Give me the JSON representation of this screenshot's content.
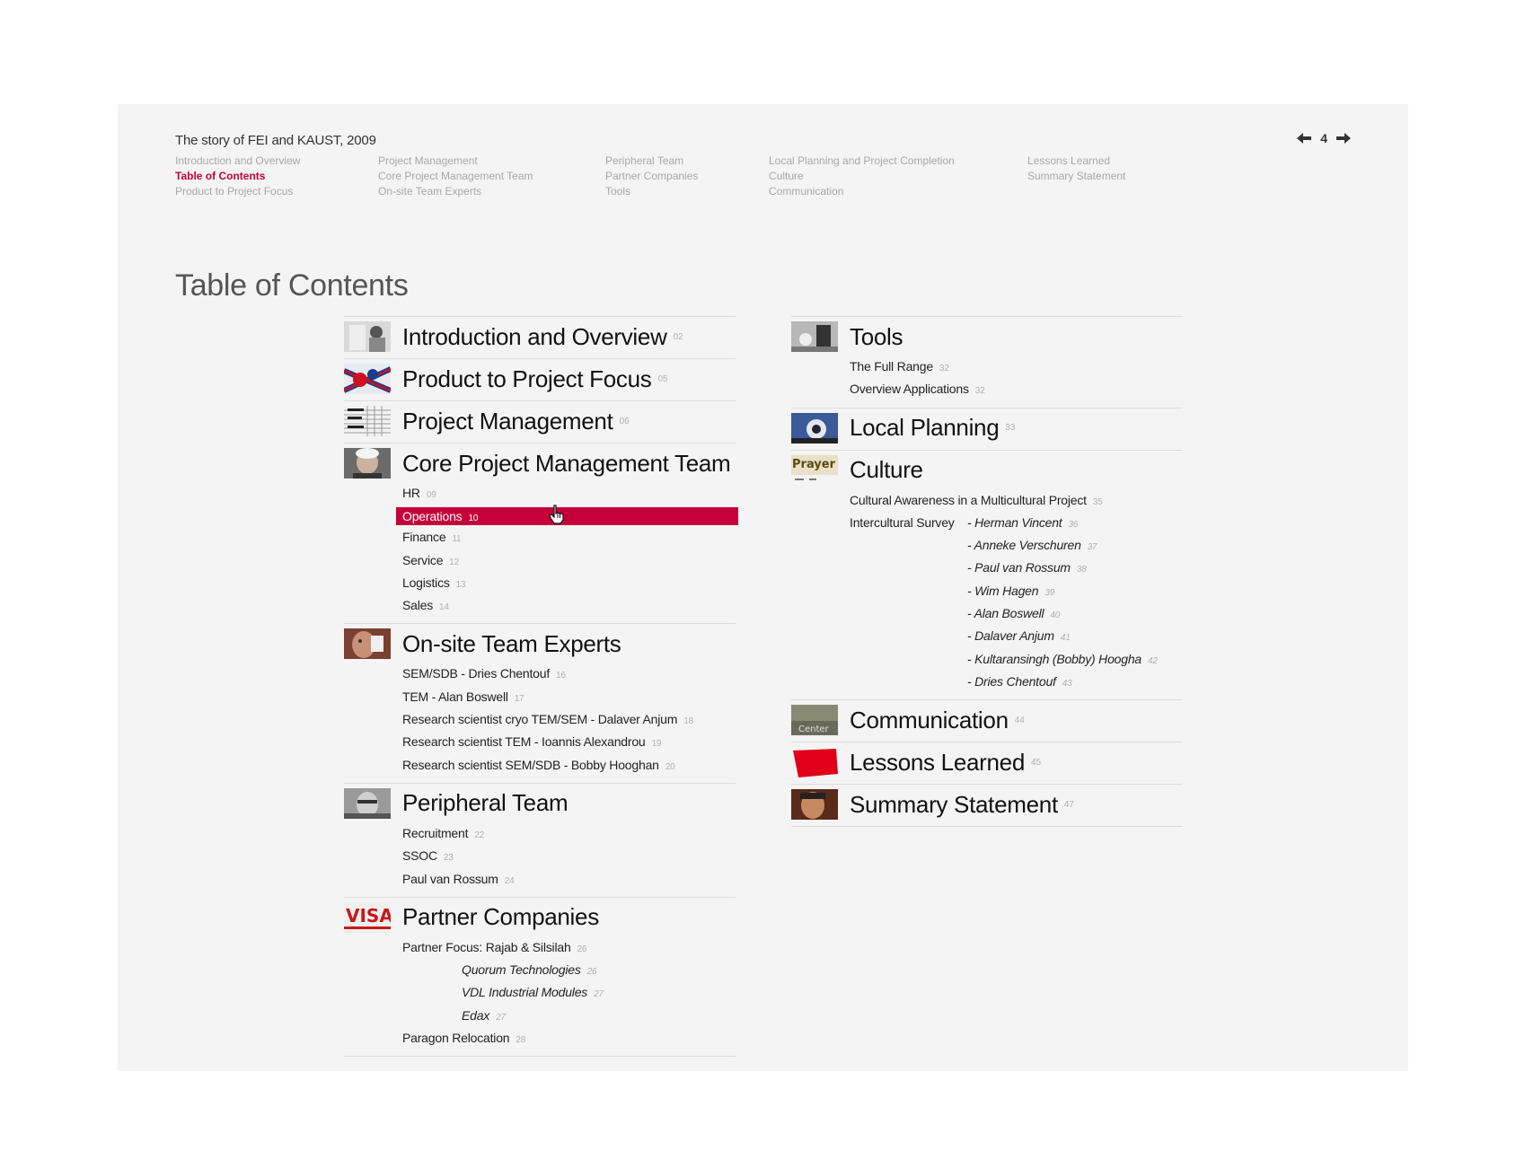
{
  "header": {
    "doc_title": "The story of FEI and KAUST, 2009",
    "page_number": "4"
  },
  "topnav": {
    "col1": [
      "Introduction and Overview",
      "Table of Contents",
      "Product to Project Focus"
    ],
    "col2": [
      "Project Management",
      "Core Project Management Team",
      "On-site Team Experts"
    ],
    "col3": [
      "Peripheral Team",
      "Partner Companies",
      "Tools"
    ],
    "col4": [
      "Local Planning and Project Completion",
      "Culture",
      "Communication"
    ],
    "col5": [
      "Lessons Learned",
      "Summary Statement"
    ]
  },
  "page_title": "Table of Contents",
  "left": {
    "intro": {
      "title": "Introduction and Overview",
      "page": "02"
    },
    "product": {
      "title": "Product to Project Focus",
      "page": "05"
    },
    "pm": {
      "title": "Project Management",
      "page": "06"
    },
    "core": {
      "title": "Core Project Management Team",
      "subs": [
        {
          "label": "HR",
          "page": "09"
        },
        {
          "label": "Operations",
          "page": "10"
        },
        {
          "label": "Finance",
          "page": "11"
        },
        {
          "label": "Service",
          "page": "12"
        },
        {
          "label": "Logistics",
          "page": "13"
        },
        {
          "label": "Sales",
          "page": "14"
        }
      ]
    },
    "onsite": {
      "title": "On-site Team Experts",
      "subs": [
        {
          "label": "SEM/SDB - Dries Chentouf",
          "page": "16"
        },
        {
          "label": "TEM - Alan Boswell",
          "page": "17"
        },
        {
          "label": "Research scientist cryo TEM/SEM - Dalaver Anjum",
          "page": "18"
        },
        {
          "label": "Research scientist TEM - Ioannis Alexandrou",
          "page": "19"
        },
        {
          "label": "Research scientist SEM/SDB - Bobby Hooghan",
          "page": "20"
        }
      ]
    },
    "peripheral": {
      "title": "Peripheral Team",
      "subs": [
        {
          "label": "Recruitment",
          "page": "22"
        },
        {
          "label": "SSOC",
          "page": "23"
        },
        {
          "label": "Paul van Rossum",
          "page": "24"
        }
      ]
    },
    "partner": {
      "title": "Partner Companies",
      "subs": [
        {
          "label": "Partner Focus: Rajab & Silsilah",
          "page": "26"
        },
        {
          "label": "Quorum Technologies",
          "page": "26"
        },
        {
          "label": "VDL Industrial Modules",
          "page": "27"
        },
        {
          "label": "Edax",
          "page": "27"
        },
        {
          "label": "Paragon Relocation",
          "page": "28"
        }
      ]
    }
  },
  "right": {
    "tools": {
      "title": "Tools",
      "subs": [
        {
          "label": "The Full Range",
          "page": "32"
        },
        {
          "label": "Overview Applications",
          "page": "32"
        }
      ]
    },
    "local": {
      "title": "Local Planning",
      "page": "33"
    },
    "culture": {
      "title": "Culture",
      "awareness": {
        "label": "Cultural Awareness in a Multicultural Project",
        "page": "35"
      },
      "survey_label": "Intercultural Survey",
      "survey": [
        {
          "label": "- Herman Vincent",
          "page": "36"
        },
        {
          "label": "- Anneke Verschuren",
          "page": "37"
        },
        {
          "label": "- Paul van Rossum",
          "page": "38"
        },
        {
          "label": "- Wim Hagen",
          "page": "39"
        },
        {
          "label": "- Alan Boswell",
          "page": "40"
        },
        {
          "label": "- Dalaver Anjum",
          "page": "41"
        },
        {
          "label": "- Kultaransingh (Bobby) Hoogha",
          "page": "42"
        },
        {
          "label": "- Dries Chentouf",
          "page": "43"
        }
      ]
    },
    "communication": {
      "title": "Communication",
      "page": "44"
    },
    "lessons": {
      "title": "Lessons Learned",
      "page": "45"
    },
    "summary": {
      "title": "Summary Statement",
      "page": "47"
    }
  },
  "thumb_text": {
    "culture": "Prayer S",
    "communication": "Center",
    "partner": "VISA"
  },
  "colors": {
    "accent": "#c6003a",
    "panel": "#f4f4f4",
    "muted": "#a8a8a8"
  }
}
